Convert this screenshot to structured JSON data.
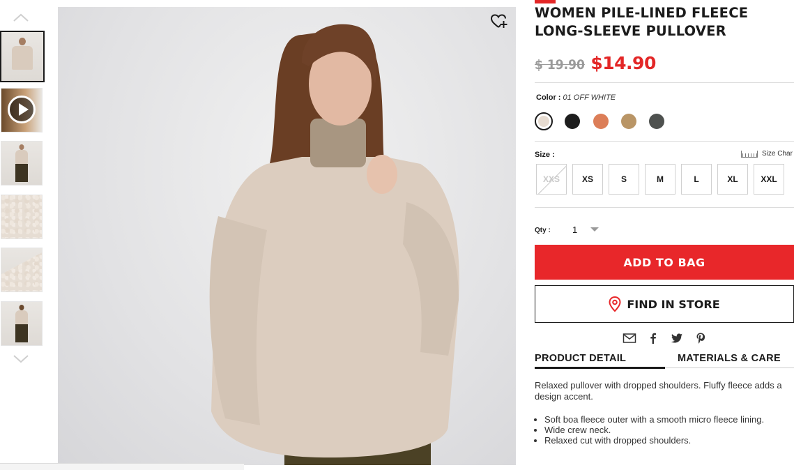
{
  "product": {
    "title": "WOMEN PILE-LINED FLEECE LONG-SLEEVE PULLOVER",
    "old_price": "$ 19.90",
    "price": "$14.90",
    "accent_color": "#e32727"
  },
  "color": {
    "label": "Color :",
    "selected": "01 OFF WHITE",
    "swatches": [
      {
        "name": "off-white",
        "hex": "#e7dcd1"
      },
      {
        "name": "black",
        "hex": "#1d1d1d"
      },
      {
        "name": "orange",
        "hex": "#dc7e58"
      },
      {
        "name": "camel",
        "hex": "#b99566"
      },
      {
        "name": "dark-gray",
        "hex": "#4e514f"
      }
    ]
  },
  "size": {
    "label": "Size :",
    "chart_label": "Size Char",
    "options": [
      {
        "label": "XXS",
        "available": false
      },
      {
        "label": "XS",
        "available": true
      },
      {
        "label": "S",
        "available": true
      },
      {
        "label": "M",
        "available": true
      },
      {
        "label": "L",
        "available": true
      },
      {
        "label": "XL",
        "available": true
      },
      {
        "label": "XXL",
        "available": true
      }
    ]
  },
  "quantity": {
    "label": "Qty :",
    "value": "1"
  },
  "actions": {
    "add_to_bag": "ADD TO BAG",
    "find_in_store": "FIND IN STORE"
  },
  "share_icons": [
    "mail-icon",
    "facebook-icon",
    "twitter-icon",
    "pinterest-icon"
  ],
  "tabs": [
    {
      "label": "PRODUCT DETAIL",
      "active": true
    },
    {
      "label": "MATERIALS & CARE",
      "active": false
    }
  ],
  "detail": {
    "description": "Relaxed pullover with dropped shoulders. Fluffy fleece adds a design accent.",
    "bullets": [
      "Soft boa fleece outer with a smooth micro fleece lining.",
      "Wide crew neck.",
      "Relaxed cut with dropped shoulders."
    ]
  },
  "gallery": {
    "thumbnails": [
      "front-view",
      "video",
      "full-body",
      "fabric-closeup",
      "hem-detail",
      "back-view"
    ],
    "active_index": 0
  }
}
